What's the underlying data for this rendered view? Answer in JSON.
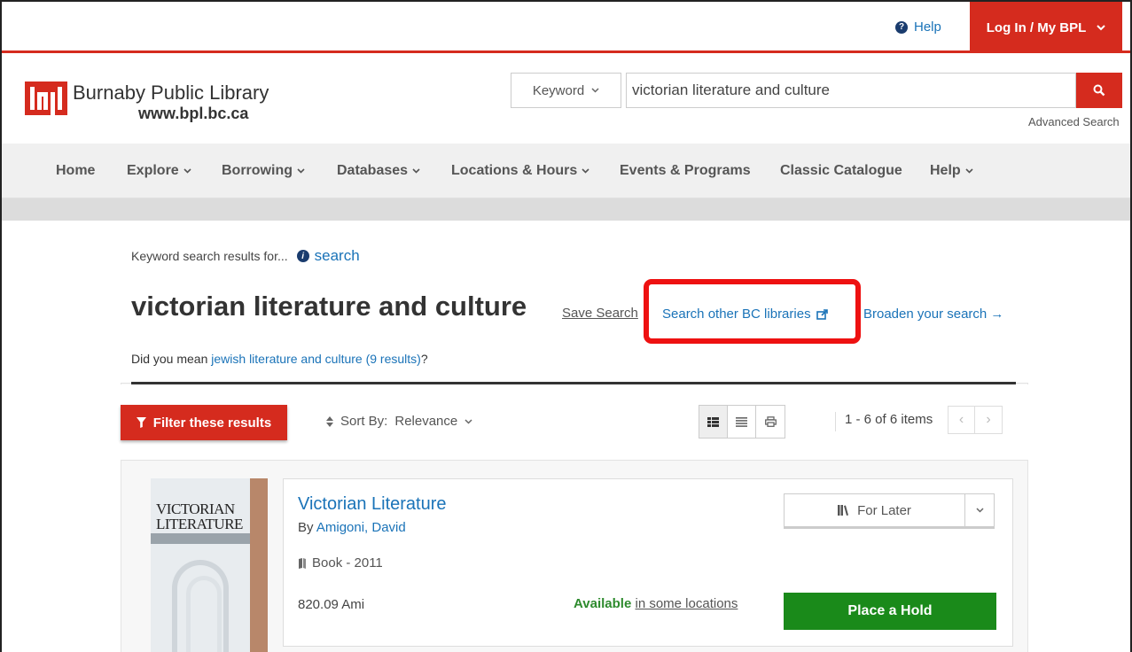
{
  "utility": {
    "help_label": "Help",
    "login_label": "Log In / My BPL"
  },
  "header": {
    "library_name": "Burnaby Public Library",
    "library_url": "www.bpl.bc.ca",
    "search_scope": "Keyword",
    "search_value": "victorian literature and culture",
    "advanced_search": "Advanced Search"
  },
  "nav": {
    "items": [
      {
        "label": "Home",
        "dropdown": false
      },
      {
        "label": "Explore",
        "dropdown": true
      },
      {
        "label": "Borrowing",
        "dropdown": true
      },
      {
        "label": "Databases",
        "dropdown": true
      },
      {
        "label": "Locations & Hours",
        "dropdown": true
      },
      {
        "label": "Events & Programs",
        "dropdown": false
      },
      {
        "label": "Classic Catalogue",
        "dropdown": false
      },
      {
        "label": "Help",
        "dropdown": true
      }
    ]
  },
  "results": {
    "intro": "Keyword search results for...",
    "info_link": "search",
    "query": "victorian literature and culture",
    "save_search": "Save Search",
    "search_other": "Search other BC libraries",
    "broaden": "Broaden your search",
    "didyoumean_prefix": "Did you mean ",
    "didyoumean_link": "jewish literature and culture (9 results)",
    "didyoumean_suffix": "?",
    "filter_label": "Filter these results",
    "sort_prefix": "Sort By:",
    "sort_value": "Relevance",
    "pager_text": "1 - 6 of 6 items"
  },
  "item": {
    "cover_title_line1": "VICTORIAN",
    "cover_title_line2": "LITERATURE",
    "title": "Victorian Literature",
    "author_prefix": "By",
    "author": "Amigoni, David",
    "format": "Book - 2011",
    "call_number": "820.09 Ami",
    "availability": "Available",
    "availability_where": "in some locations",
    "for_later": "For Later",
    "hold": "Place a Hold"
  },
  "colors": {
    "brand_red": "#d52b1e",
    "link_blue": "#1a73b8",
    "available_green": "#2e8b2e",
    "hold_green": "#1a8a1a",
    "highlight_red": "#ee1111"
  }
}
